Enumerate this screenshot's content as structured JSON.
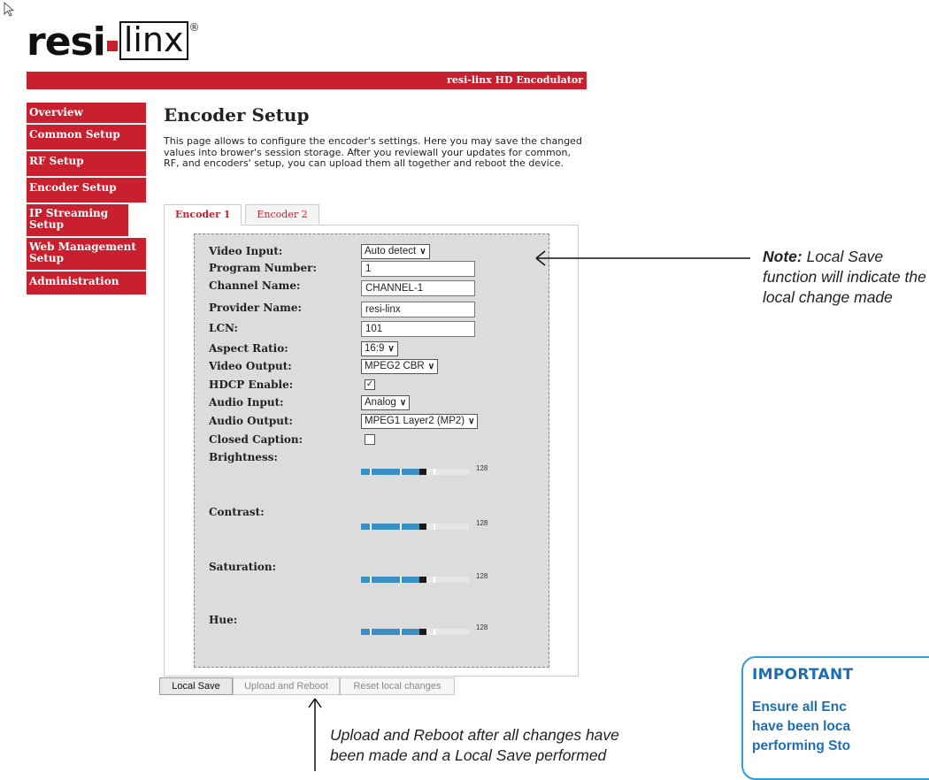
{
  "logo": {
    "part1": "resi",
    "part2": "linx",
    "mark": "®"
  },
  "banner": {
    "title": "resi-linx HD Encodulator"
  },
  "sidebar": {
    "items": [
      {
        "label": "Overview"
      },
      {
        "label": "Common Setup"
      },
      {
        "label": "RF Setup"
      },
      {
        "label": "Encoder Setup"
      },
      {
        "label": "IP Streaming Setup"
      },
      {
        "label": "Web Management Setup"
      },
      {
        "label": "Administration"
      }
    ]
  },
  "page": {
    "title": "Encoder Setup",
    "intro": "This page allows to configure the encoder's settings. Here you may save the changed values into brower's session storage. After you reviewall your updates for common, RF, and encoders' setup, you can upload them all together and reboot the device."
  },
  "tabs": [
    {
      "label": "Encoder 1",
      "active": true
    },
    {
      "label": "Encoder 2",
      "active": false
    }
  ],
  "form": {
    "video_input": {
      "label": "Video Input:",
      "value": "Auto detect"
    },
    "program_number": {
      "label": "Program Number:",
      "value": "1"
    },
    "channel_name": {
      "label": "Channel Name:",
      "value": "CHANNEL-1"
    },
    "provider_name": {
      "label": "Provider Name:",
      "value": "resi-linx"
    },
    "lcn": {
      "label": "LCN:",
      "value": "101"
    },
    "aspect_ratio": {
      "label": "Aspect Ratio:",
      "value": "16:9"
    },
    "video_output": {
      "label": "Video Output:",
      "value": "MPEG2 CBR"
    },
    "hdcp_enable": {
      "label": "HDCP Enable:",
      "checked": true,
      "mark": "✓"
    },
    "audio_input": {
      "label": "Audio Input:",
      "value": "Analog"
    },
    "audio_output": {
      "label": "Audio Output:",
      "value": "MPEG1 Layer2 (MP2)"
    },
    "closed_caption": {
      "label": "Closed Caption:",
      "checked": false
    },
    "brightness": {
      "label": "Brightness:",
      "value": "128"
    },
    "contrast": {
      "label": "Contrast:",
      "value": "128"
    },
    "saturation": {
      "label": "Saturation:",
      "value": "128"
    },
    "hue": {
      "label": "Hue:",
      "value": "128"
    }
  },
  "buttons": {
    "local_save": "Local Save",
    "upload_reboot": "Upload and Reboot",
    "reset_local": "Reset local changes"
  },
  "annotations": {
    "note_bold": "Note:",
    "note_rest": " Local Save function will indicate the local change made",
    "upload_line1": "Upload and Reboot after all changes have",
    "upload_line2": "been made and a Local Save performed",
    "important_title": "IMPORTANT",
    "important_line1": "Ensure all Enc",
    "important_line2": "have been loca",
    "important_line3": "performing Sto"
  },
  "colors": {
    "brand_red": "#c8202e",
    "slider_blue": "#3a8fc4",
    "important_blue": "#1f6fb0"
  }
}
